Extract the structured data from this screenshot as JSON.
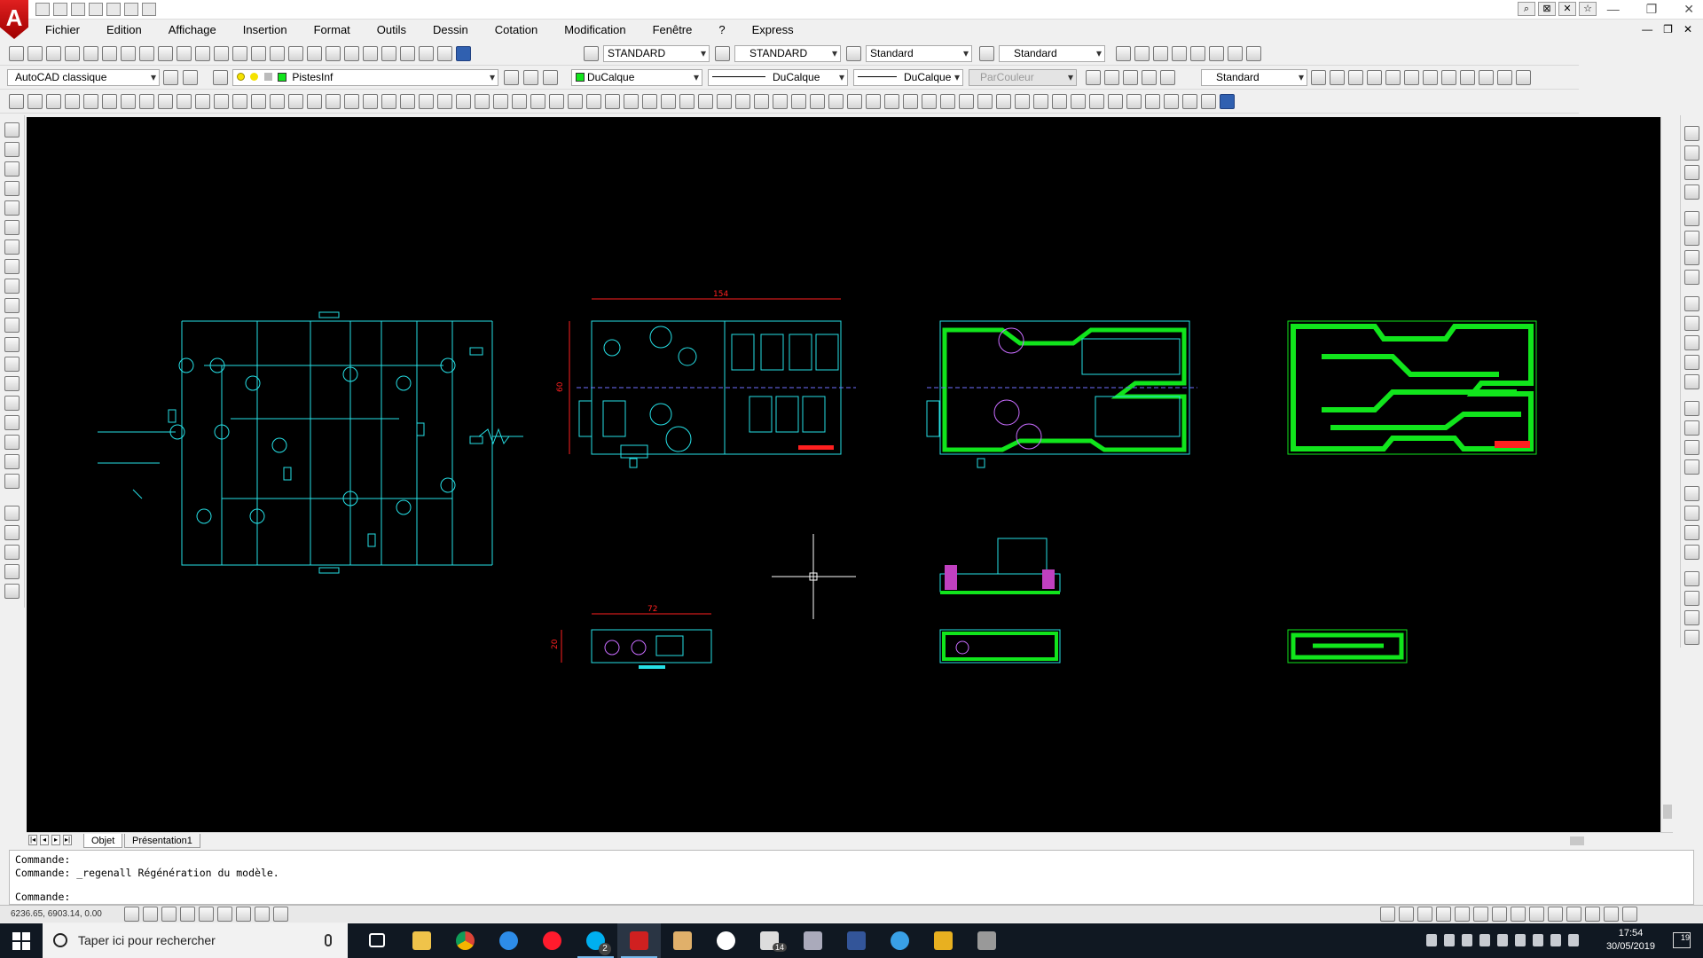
{
  "menu": {
    "items": [
      "Fichier",
      "Edition",
      "Affichage",
      "Insertion",
      "Format",
      "Outils",
      "Dessin",
      "Cotation",
      "Modification",
      "Fenêtre",
      "?",
      "Express"
    ]
  },
  "toolbar1": {
    "text_style": "STANDARD",
    "dim_style": "STANDARD",
    "table_style": "Standard",
    "multileader_style": "Standard"
  },
  "toolbar2": {
    "workspace": "AutoCAD classique",
    "layer": "PistesInf",
    "color": "DuCalque",
    "linetype": "DuCalque",
    "lineweight": "DuCalque",
    "plotstyle": "ParCouleur",
    "visual_style": "Standard",
    "layer_color": "#11e51c"
  },
  "canvas": {
    "background": "#000000",
    "dim_top_pcb": "154",
    "dim_left_pcb": "60",
    "dim_small_pcb": "72",
    "dim_small_left": "20"
  },
  "layout_tabs": [
    "Objet",
    "Présentation1"
  ],
  "command": {
    "line1": "Commande:",
    "line2": "Commande: _regenall Régénération du modèle.",
    "prompt": "Commande:"
  },
  "status": {
    "coordinates": "6236.65, 6903.14, 0.00"
  },
  "taskbar": {
    "search_placeholder": "Taper ici pour rechercher",
    "time": "17:54",
    "date": "30/05/2019",
    "skype_badge": "2",
    "mail_badge": "14",
    "notifications": "19"
  }
}
